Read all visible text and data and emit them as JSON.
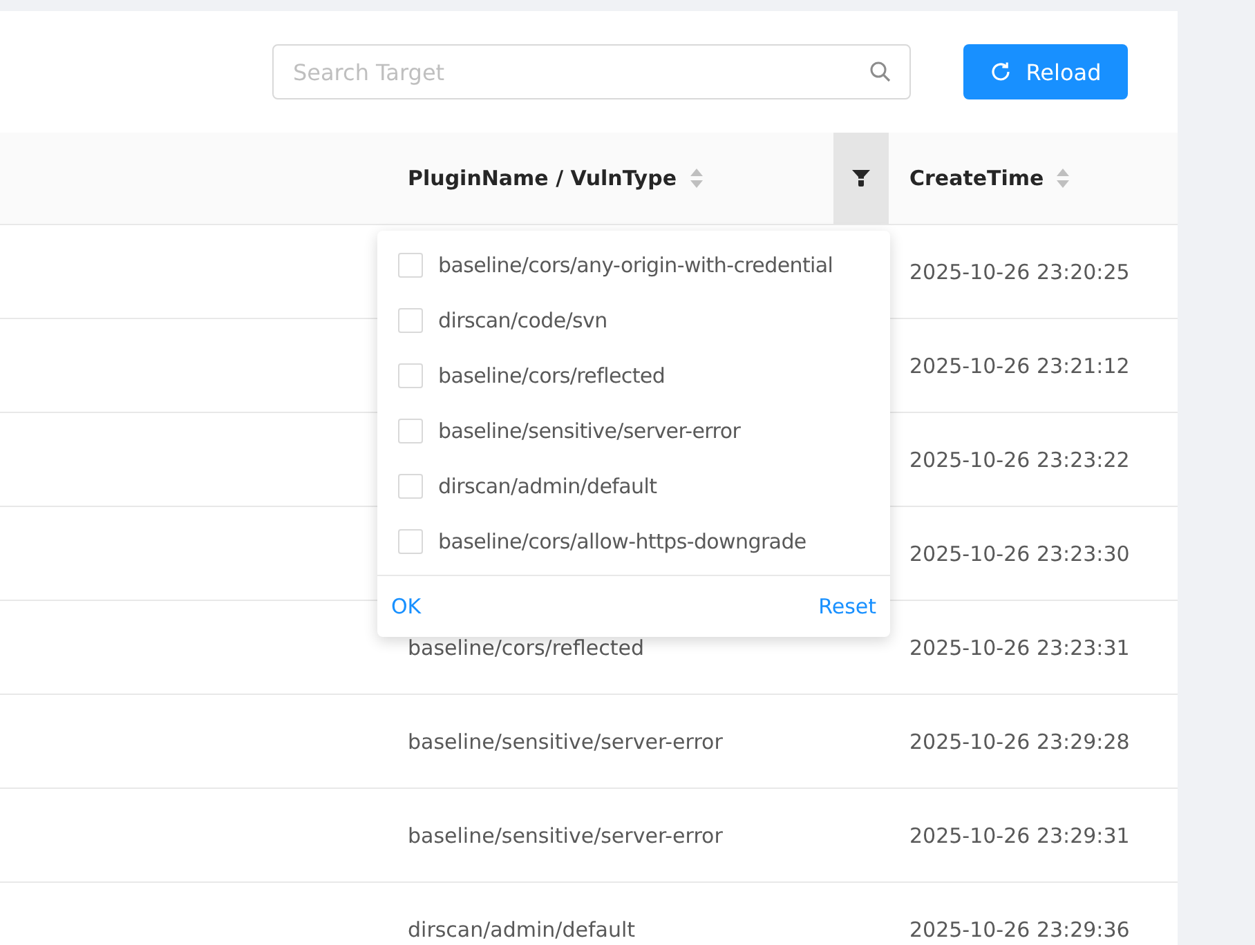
{
  "search": {
    "placeholder": "Search Target"
  },
  "reload_button": {
    "label": "Reload"
  },
  "table": {
    "columns": [
      {
        "label": "PluginName / VulnType",
        "sortable": true,
        "filter": true
      },
      {
        "label": "CreateTime",
        "sortable": true,
        "filter": false
      }
    ],
    "rows": [
      {
        "create_time": "2025-10-26 23:20:25"
      },
      {
        "create_time": "2025-10-26 23:21:12"
      },
      {
        "create_time": "2025-10-26 23:23:22"
      },
      {
        "create_time": "2025-10-26 23:23:30"
      },
      {
        "plugin": "baseline/cors/reflected",
        "create_time": "2025-10-26 23:23:31"
      },
      {
        "plugin": "baseline/sensitive/server-error",
        "create_time": "2025-10-26 23:29:28"
      },
      {
        "plugin": "baseline/sensitive/server-error",
        "create_time": "2025-10-26 23:29:31"
      },
      {
        "plugin": "dirscan/admin/default",
        "create_time": "2025-10-26 23:29:36"
      }
    ]
  },
  "filter_dropdown": {
    "open": true,
    "options": [
      {
        "label": "baseline/cors/any-origin-with-credential",
        "checked": false
      },
      {
        "label": "dirscan/code/svn",
        "checked": false
      },
      {
        "label": "baseline/cors/reflected",
        "checked": false
      },
      {
        "label": "baseline/sensitive/server-error",
        "checked": false
      },
      {
        "label": "dirscan/admin/default",
        "checked": false
      },
      {
        "label": "baseline/cors/allow-https-downgrade",
        "checked": false
      }
    ],
    "ok": "OK",
    "reset": "Reset"
  }
}
